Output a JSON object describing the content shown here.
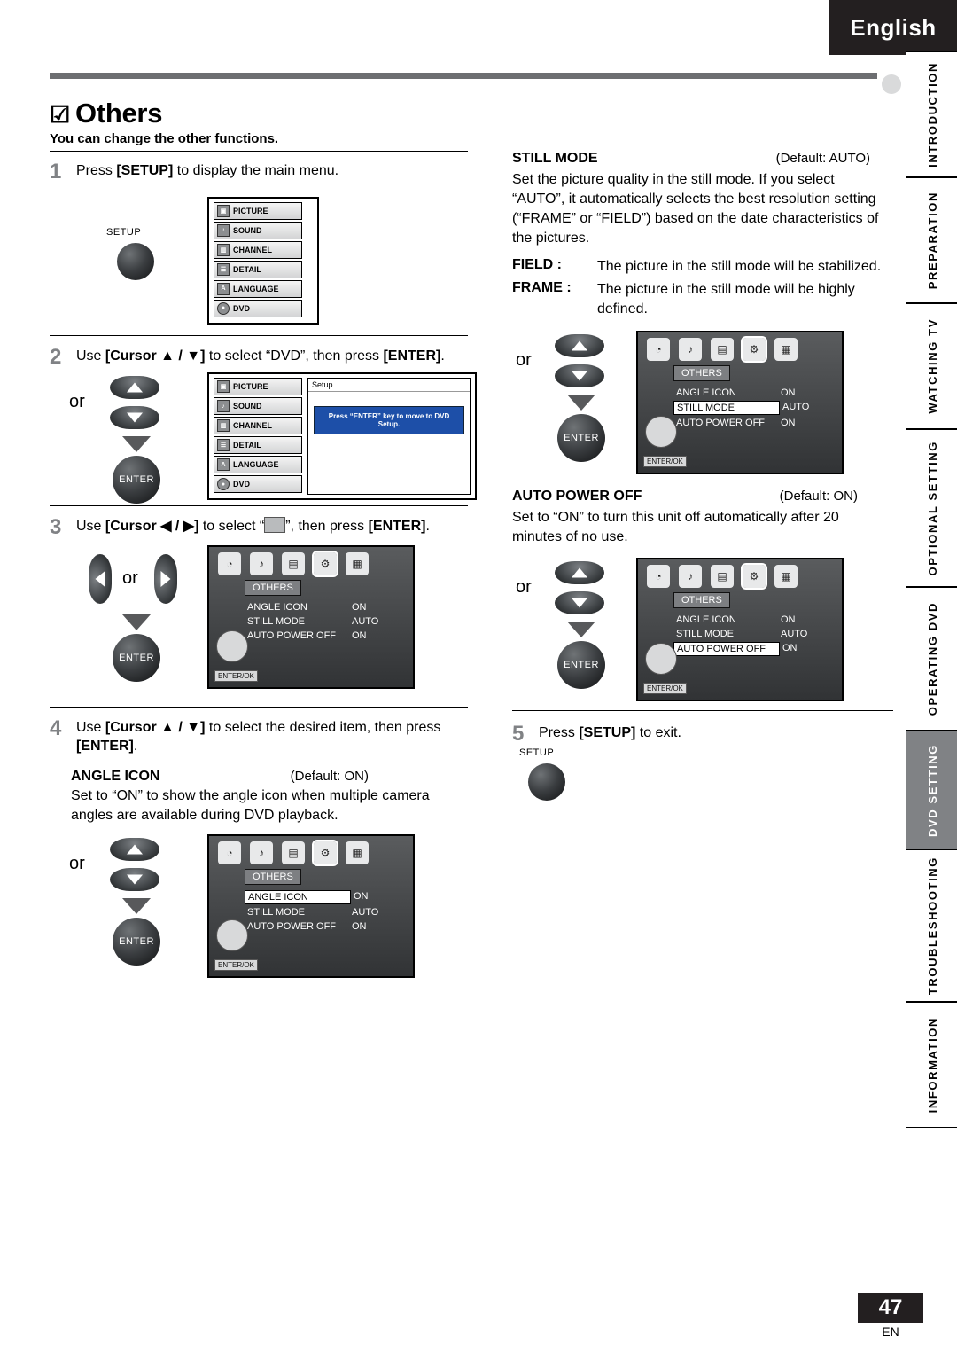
{
  "header": {
    "language_tab": "English",
    "page_number": "47",
    "page_suffix": "EN"
  },
  "title": {
    "mark": "☑",
    "text": "Others",
    "subtitle": "You can change the other functions."
  },
  "steps": [
    {
      "num": "1",
      "text_parts": [
        "Press ",
        "[SETUP]",
        " to display the main menu."
      ],
      "button_label": "SETUP"
    },
    {
      "num": "2",
      "text_parts": [
        "Use ",
        "[Cursor ▲ / ▼]",
        " to select “DVD”, then press ",
        "[ENTER]",
        "."
      ],
      "or": "or",
      "enter": "ENTER",
      "tooltip": "Press “ENTER” key to move to DVD Setup.",
      "menu_title": "Setup"
    },
    {
      "num": "3",
      "text_parts": [
        "Use ",
        "[Cursor ◀ / ▶]",
        " to select “",
        "”, then press ",
        "[ENTER]",
        "."
      ],
      "or": "or",
      "enter": "ENTER"
    },
    {
      "num": "4",
      "text_parts": [
        "Use ",
        "[Cursor ▲ / ▼]",
        " to select the desired item, then press ",
        "[ENTER]",
        "."
      ],
      "or": "or",
      "enter": "ENTER"
    },
    {
      "num": "5",
      "text_parts": [
        "Press ",
        "[SETUP]",
        " to exit."
      ],
      "button_label": "SETUP"
    }
  ],
  "setup_menu": {
    "items": [
      {
        "label": "PICTURE",
        "icon": "picture-icon"
      },
      {
        "label": "SOUND",
        "icon": "sound-icon"
      },
      {
        "label": "CHANNEL",
        "icon": "channel-icon"
      },
      {
        "label": "DETAIL",
        "icon": "detail-icon"
      },
      {
        "label": "LANGUAGE",
        "icon": "language-icon"
      },
      {
        "label": "DVD",
        "icon": "dvd-icon"
      }
    ]
  },
  "osd": {
    "title": "OTHERS",
    "enter_ok": "ENTER/OK",
    "rows": [
      {
        "name": "ANGLE ICON",
        "value": "ON"
      },
      {
        "name": "STILL MODE",
        "value": "AUTO"
      },
      {
        "name": "AUTO POWER OFF",
        "value": "ON"
      }
    ],
    "icons": [
      "picture-osd-icon",
      "sound-osd-icon",
      "display-osd-icon",
      "others-osd-icon",
      "rating-osd-icon"
    ]
  },
  "settings": {
    "angle_icon": {
      "name": "ANGLE ICON",
      "default": "(Default: ON)",
      "description": "Set to “ON” to show the angle icon when multiple camera angles are available during DVD playback."
    },
    "still_mode": {
      "name": "STILL MODE",
      "default": "(Default: AUTO)",
      "description": "Set the picture quality in the still mode. If you select “AUTO”, it automatically selects the best resolution setting (“FRAME” or “FIELD”) based on the date characteristics of the pictures.",
      "options": [
        {
          "label": "FIELD :",
          "text": "The picture in the still mode will be stabilized."
        },
        {
          "label": "FRAME :",
          "text": "The picture in the still mode will be highly defined."
        }
      ]
    },
    "auto_power_off": {
      "name": "AUTO POWER OFF",
      "default": "(Default: ON)",
      "description": "Set to “ON” to turn this unit off automatically after 20 minutes of no use."
    }
  },
  "side_tabs": [
    {
      "label": "INTRODUCTION",
      "active": false
    },
    {
      "label": "PREPARATION",
      "active": false
    },
    {
      "label": "WATCHING TV",
      "active": false
    },
    {
      "label": "OPTIONAL SETTING",
      "active": false
    },
    {
      "label": "OPERATING DVD",
      "active": false
    },
    {
      "label": "DVD SETTING",
      "active": true
    },
    {
      "label": "TROUBLESHOOTING",
      "active": false
    },
    {
      "label": "INFORMATION",
      "active": false
    }
  ]
}
